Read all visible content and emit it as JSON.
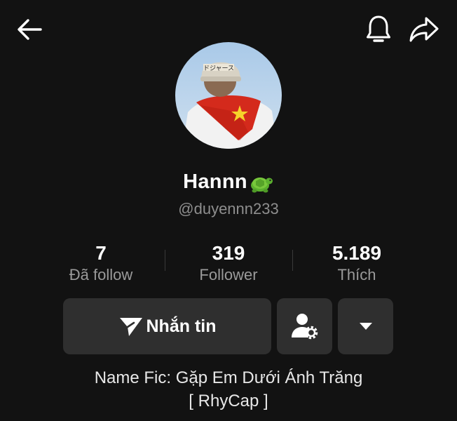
{
  "header": {
    "back_icon": "arrow-left-icon",
    "notification_icon": "bell-icon",
    "share_icon": "share-arrow-icon"
  },
  "profile": {
    "display_name": "Hannn",
    "name_emoji": "turtle-emoji",
    "username": "@duyennn233",
    "avatar_cap_text": "ドジャース"
  },
  "stats": [
    {
      "value": "7",
      "label": "Đã follow"
    },
    {
      "value": "319",
      "label": "Follower"
    },
    {
      "value": "5.189",
      "label": "Thích"
    }
  ],
  "actions": {
    "message_label": "Nhắn tin",
    "message_icon": "send-icon",
    "friend_settings_icon": "user-settings-icon",
    "more_icon": "caret-down-icon"
  },
  "bio": {
    "line1": "Name Fic: Gặp Em Dưới Ánh Trăng",
    "line2": "[ RhyCap ]"
  },
  "colors": {
    "background": "#121212",
    "button": "#2f2f2f",
    "secondary_text": "#8e8e8e"
  }
}
